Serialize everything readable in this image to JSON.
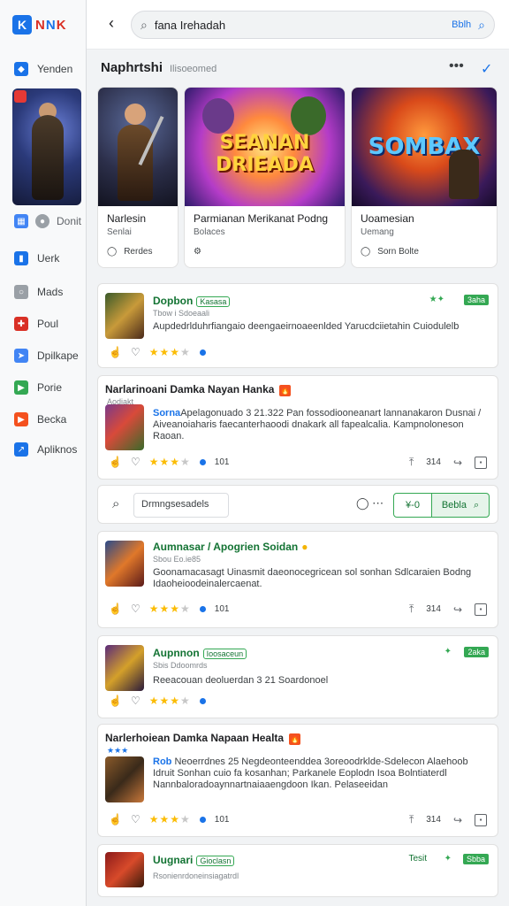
{
  "app": {
    "logo_mark": "K",
    "logo_text_a": "N",
    "logo_text_b": "N",
    "logo_text_c": "K"
  },
  "sidebar": {
    "items": [
      {
        "label": "Yenden",
        "icon": "controller-icon",
        "color": "#1a73e8"
      },
      {
        "label": "Uerk",
        "icon": "bars-icon",
        "color": "#1a73e8"
      },
      {
        "label": "Mads",
        "icon": "circle-icon",
        "color": "#5f6368"
      },
      {
        "label": "Poul",
        "icon": "puzzle-icon",
        "color": "#d93025"
      },
      {
        "label": "Dpilkape",
        "icon": "send-icon",
        "color": "#4285f4"
      },
      {
        "label": "Porie",
        "icon": "play-icon",
        "color": "#34a853"
      },
      {
        "label": "Becka",
        "icon": "book-icon",
        "color": "#f4511e"
      },
      {
        "label": "Apliknos",
        "icon": "share-icon",
        "color": "#1a73e8"
      }
    ],
    "pair_label": "Donit"
  },
  "search": {
    "value": "fana Irehadah",
    "extra": "Bblh",
    "placeholder": "Search"
  },
  "section": {
    "title": "Naphrtshi",
    "subtitle": "Ilisoeomed"
  },
  "featured": [
    {
      "art_text": "",
      "title": "Narlesin",
      "sub": "Senlai",
      "action": "Rerdes"
    },
    {
      "art_text": "SEANAN DRIEADA",
      "title": "Parmianan Merikanat Podng",
      "sub": "Bolaces",
      "action": ""
    },
    {
      "art_text": "SOMBAX",
      "title": "Uoamesian",
      "sub": "Uemang",
      "action": "Sorn   Bolte"
    }
  ],
  "list": [
    {
      "name": "Dopbon",
      "tag": "Kasasa",
      "meta": "Tbow i Sdoeaali",
      "desc": "Aupdedrlduhrfiangaio deengaeirnoaeenlded Yarucdciietahin Cuiodulelb",
      "stars": 3,
      "badge": "3aha",
      "count": ""
    },
    {
      "heading": "Narlarinoani Damka Nayan Hanka",
      "name": "Sorna",
      "meta": "Aodiakt",
      "desc": "Apelagonuado 3 21.322 Pan fossodiooneanart lannanakaron Dusnai / Aiveanoiaharis faecanterhaoodi dnakark all fapealcalia. Kampnoloneson Raoan.",
      "stars": 3,
      "count": "101",
      "count2": "314"
    },
    {
      "name": "Aumnasar / Apogrien Soidan",
      "meta": "Sbou Eo.ie85",
      "desc": "Goonamacasagt Uinasmit daeonocegricean sol sonhan Sdlcaraien Bodng Idaoheioodeinalercaenat.",
      "stars": 3,
      "count": "101",
      "count2": "314"
    },
    {
      "name": "Aupnnon",
      "tag": "Ioosaceun",
      "meta": "Sbis Ddoomrds",
      "desc": "Reeacouan deoluerdan 3 21 Soardonoel",
      "stars": 3,
      "badge": "2aka",
      "count": ""
    },
    {
      "heading": "Narlerhoiean Damka Napaan Healta",
      "name": "Rob",
      "meta": "Neoerrdnes 25",
      "desc": "Negdeonteenddea 3oreoodrklde-Sdelecon Alaehoob Idruit  Sonhan cuio fa kosanhan; Parkanele Eoplodn Isoa Bolntiaterdl Nannbaloradoaynnartnaiaaengdoon Ikan. Pelaseeidan",
      "stars": 3,
      "count": "101",
      "count2": "314"
    },
    {
      "name": "Uugnari",
      "tag": "Gioclasn",
      "meta": "Rsonienrdoneinsiagatrdl",
      "desc": "",
      "stars": 0,
      "badge": "Sbba",
      "badge_lead": "Tesit"
    }
  ],
  "filter": {
    "input": "Drmngsesadels",
    "chip1": "¥-0",
    "chip2": "Bebla"
  },
  "colors": {
    "accent": "#1a73e8",
    "green": "#34a853",
    "star": "#fbbc04"
  }
}
